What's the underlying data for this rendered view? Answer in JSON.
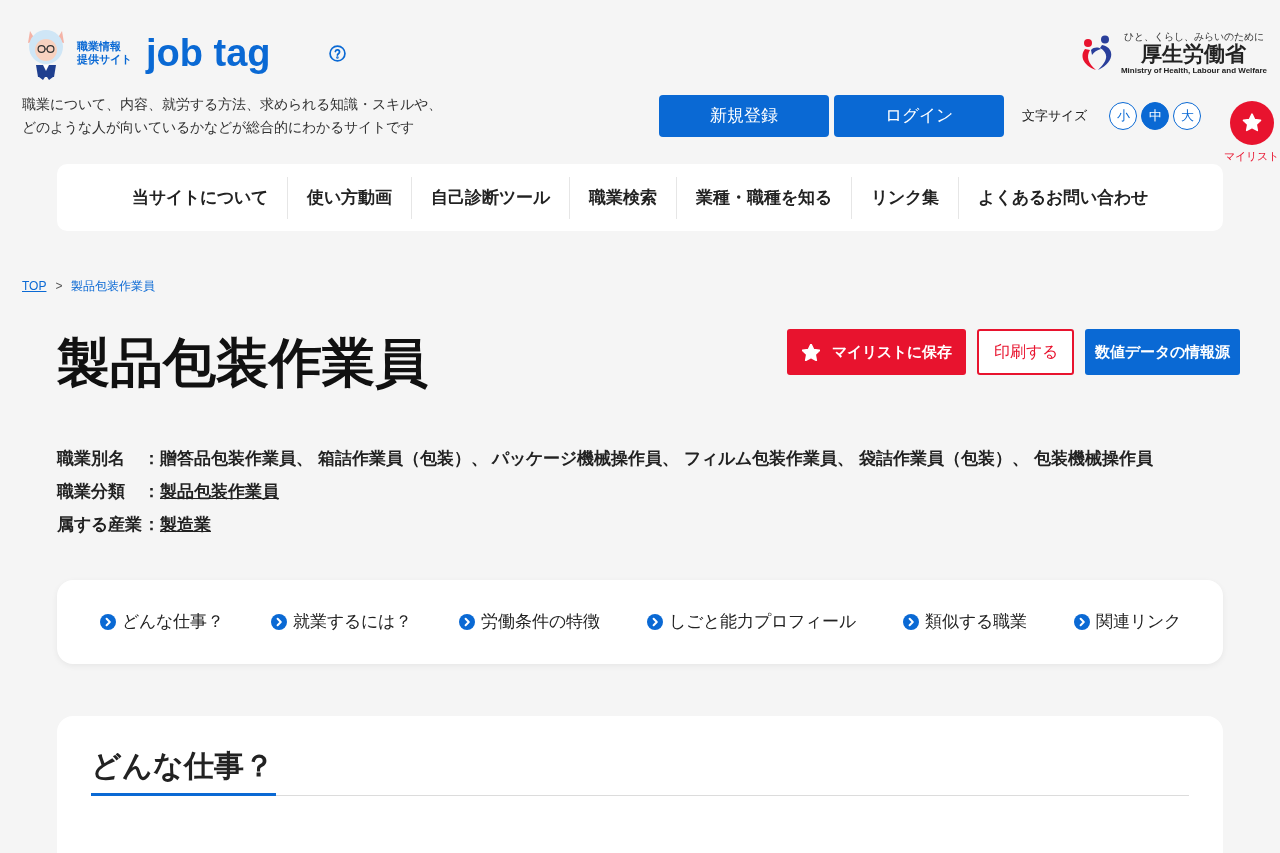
{
  "header": {
    "logo": {
      "subtitle_lines": [
        "職業情報",
        "提供サイト"
      ],
      "name": "job tag"
    },
    "ministry": {
      "tagline": "ひと、くらし、みらいのために",
      "name": "厚生労働省",
      "english": "Ministry of Health, Labour and Welfare"
    },
    "description_lines": [
      "職業について、内容、就労する方法、求められる知識・スキルや、",
      "どのような人が向いているかなどが総合的にわかるサイトです"
    ],
    "buttons": [
      "新規登録",
      "ログイン"
    ],
    "font_size": {
      "label": "文字サイズ",
      "options": [
        {
          "label": "小",
          "selected": false
        },
        {
          "label": "中",
          "selected": true
        },
        {
          "label": "大",
          "selected": false
        }
      ]
    },
    "mylist": {
      "label": "マイリスト"
    }
  },
  "nav": [
    "当サイトについて",
    "使い方動画",
    "自己診断ツール",
    "職業検索",
    "業種・職種を知る",
    "リンク集",
    "よくあるお問い合わせ"
  ],
  "breadcrumb": {
    "separator": ">",
    "items": [
      {
        "label": "TOP",
        "kind": "link"
      },
      {
        "label": "製品包装作業員",
        "kind": "current"
      }
    ]
  },
  "title": "製品包装作業員",
  "actions": [
    {
      "label": "マイリストに保存",
      "kind": "save"
    },
    {
      "label": "印刷する",
      "kind": "print"
    },
    {
      "label": "数値データの情報源",
      "kind": "source"
    }
  ],
  "attributes": [
    {
      "label": "職業別名",
      "colon": "：",
      "value": "贈答品包装作業員、 箱詰作業員（包装）、 パッケージ機械操作員、 フィルム包装作業員、 袋詰作業員（包装）、 包装機械操作員",
      "kind": "text"
    },
    {
      "label": "職業分類",
      "colon": "：",
      "value": "製品包装作業員",
      "kind": "link"
    },
    {
      "label": "属する産業",
      "colon": "：",
      "value": "製造業",
      "kind": "link"
    }
  ],
  "anchors": [
    "どんな仕事？",
    "就業するには？",
    "労働条件の特徴",
    "しごと能力プロフィール",
    "類似する職業",
    "関連リンク"
  ],
  "section": {
    "heading": "どんな仕事？"
  }
}
